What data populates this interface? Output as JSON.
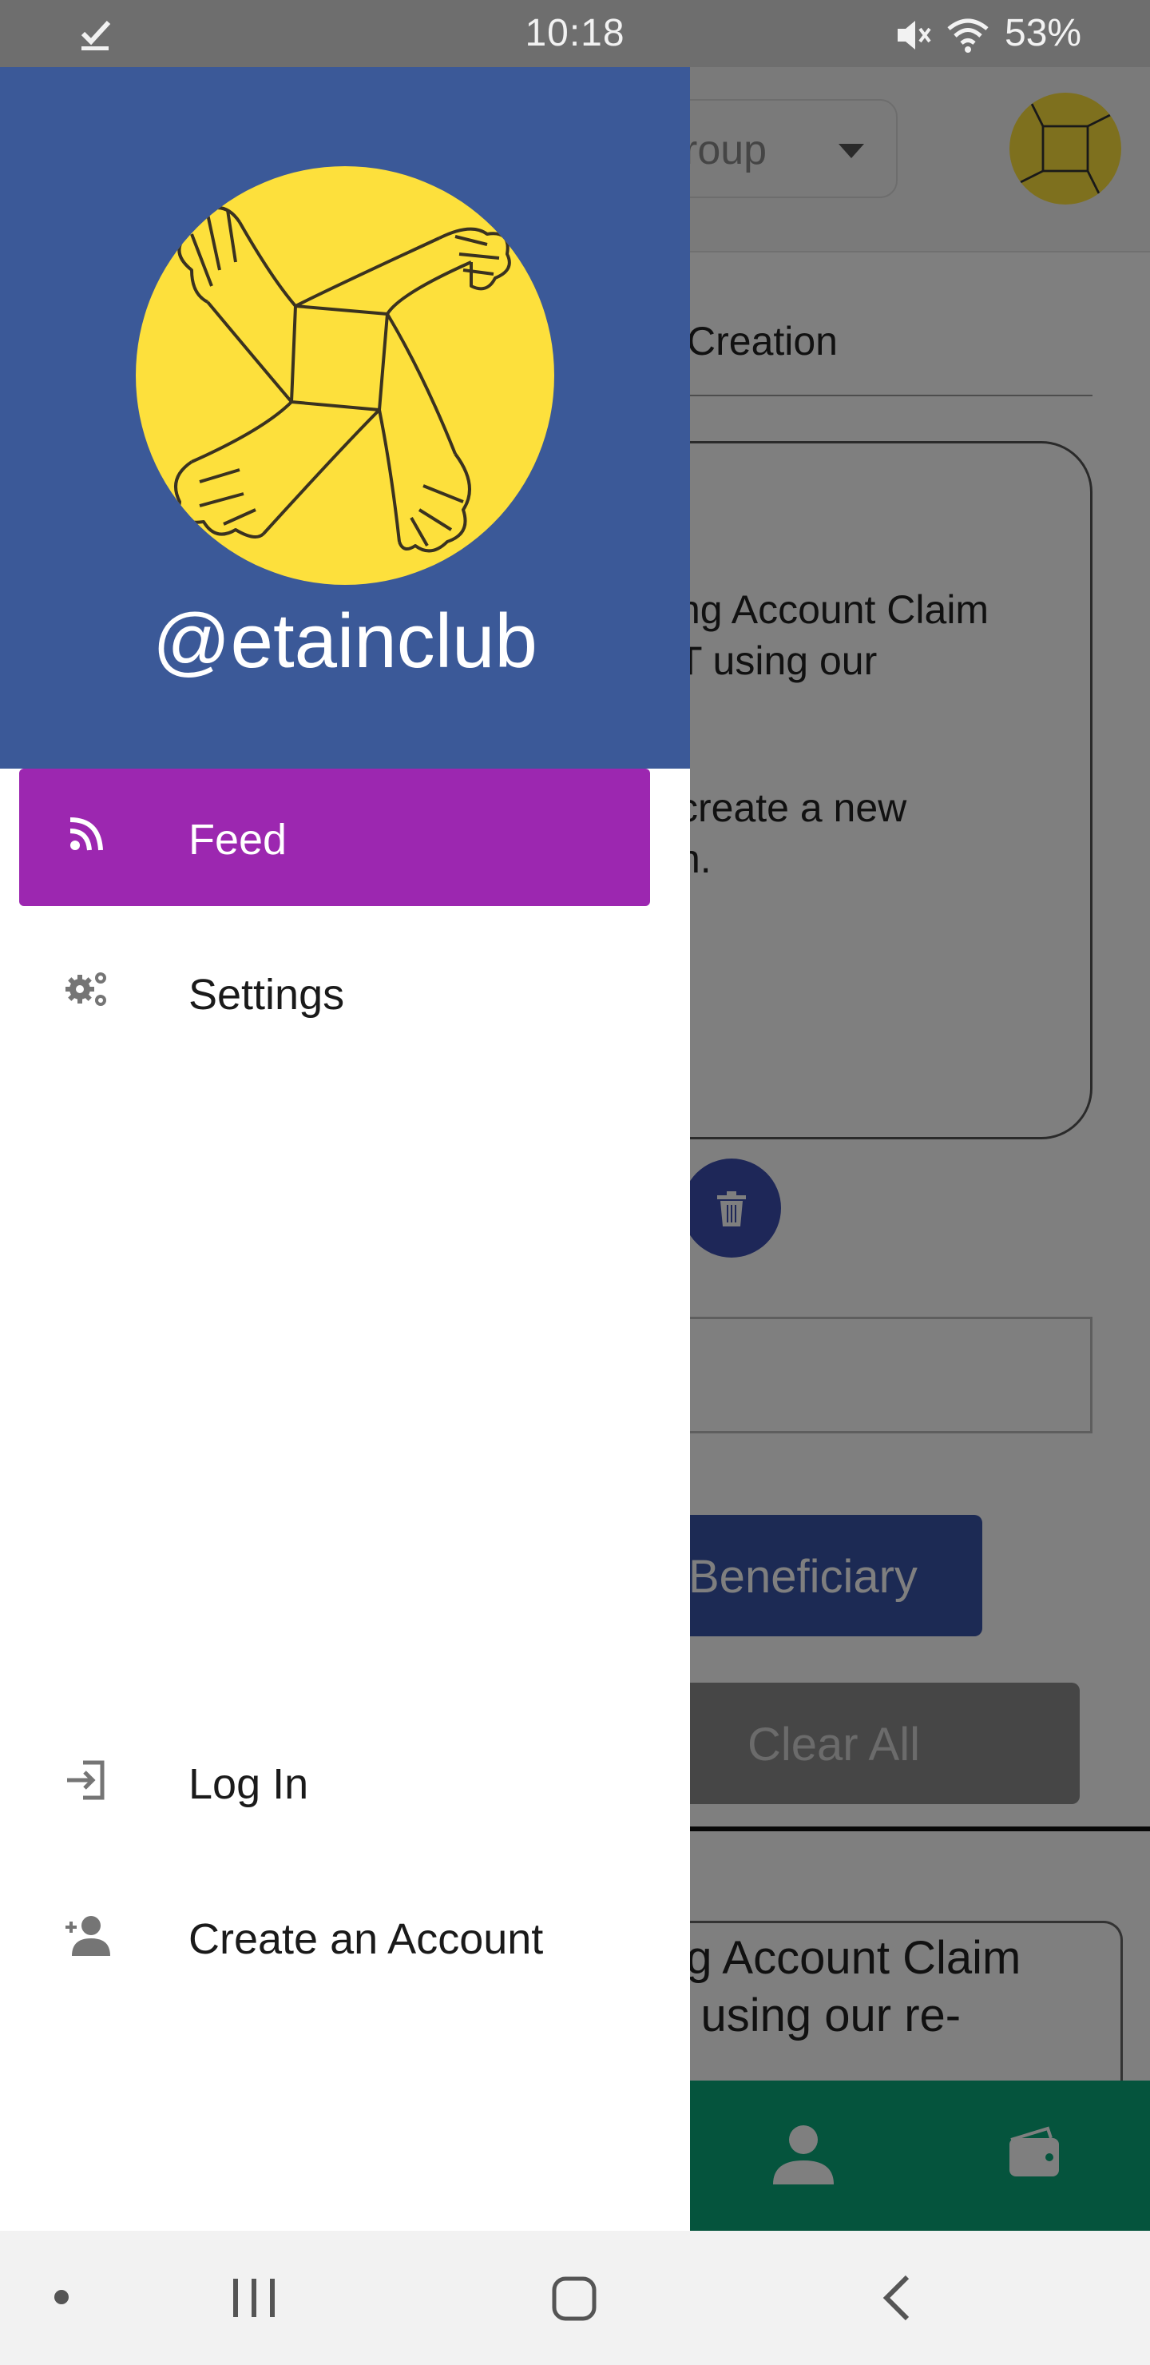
{
  "status_bar": {
    "time": "10:18",
    "battery": "53%",
    "icons": [
      "check-icon",
      "mute-icon",
      "wifi-icon"
    ]
  },
  "background_app": {
    "group_select_value": "roup",
    "title_field_value": "Creation",
    "textarea_line1": "ng Account Claim",
    "textarea_line2": "T using our",
    "textarea_line3": "create a new",
    "textarea_line4": "n.",
    "beneficiary_button": "Beneficiary",
    "clear_button": "Clear All",
    "card_line1": "ng Account Claim",
    "card_line2": "T using our re-",
    "bottom_nav_icons": [
      "person-icon",
      "wallet-icon"
    ],
    "colors": {
      "bottom_nav": "#0aa87a",
      "primary_button": "#3954a8",
      "fab": "#3d4fb0"
    }
  },
  "drawer": {
    "username": "@etainclub",
    "header_color": "#3b5998",
    "logo_color": "#fde03c",
    "active_color": "#9c27b0",
    "items": [
      {
        "label": "Feed",
        "icon": "rss-icon",
        "active": true
      },
      {
        "label": "Settings",
        "icon": "gears-icon",
        "active": false
      }
    ],
    "bottom_items": [
      {
        "label": "Log In",
        "icon": "login-icon"
      },
      {
        "label": "Create an Account",
        "icon": "add-user-icon"
      }
    ]
  },
  "system_nav": {
    "icons": [
      "recents-icon",
      "home-icon",
      "back-icon"
    ]
  }
}
